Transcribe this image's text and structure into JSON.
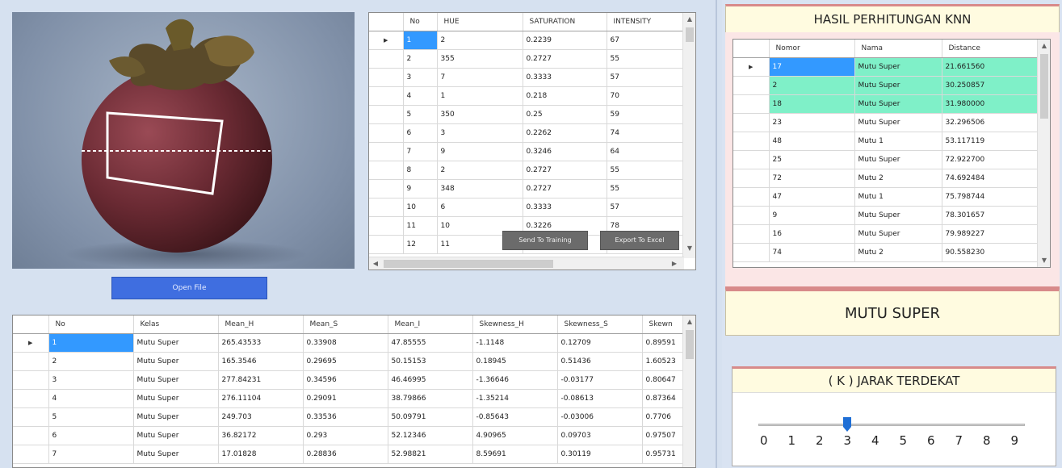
{
  "buttons": {
    "open_file": "Open File",
    "send_training": "Send To Training",
    "export_excel": "Export To Excel"
  },
  "pixel_grid": {
    "columns": [
      "No",
      "HUE",
      "SATURATION",
      "INTENSITY"
    ],
    "rows": [
      [
        "1",
        "2",
        "0.2239",
        "67"
      ],
      [
        "2",
        "355",
        "0.2727",
        "55"
      ],
      [
        "3",
        "7",
        "0.3333",
        "57"
      ],
      [
        "4",
        "1",
        "0.218",
        "70"
      ],
      [
        "5",
        "350",
        "0.25",
        "59"
      ],
      [
        "6",
        "3",
        "0.2262",
        "74"
      ],
      [
        "7",
        "9",
        "0.3246",
        "64"
      ],
      [
        "8",
        "2",
        "0.2727",
        "55"
      ],
      [
        "9",
        "348",
        "0.2727",
        "55"
      ],
      [
        "10",
        "6",
        "0.3333",
        "57"
      ],
      [
        "11",
        "10",
        "0.3226",
        "78"
      ],
      [
        "12",
        "11",
        "",
        ""
      ]
    ]
  },
  "training_grid": {
    "columns": [
      "No",
      "Kelas",
      "Mean_H",
      "Mean_S",
      "Mean_I",
      "Skewness_H",
      "Skewness_S",
      "Skewn"
    ],
    "rows": [
      [
        "1",
        "Mutu Super",
        "265.43533",
        "0.33908",
        "47.85555",
        "-1.1148",
        "0.12709",
        "0.89591"
      ],
      [
        "2",
        "Mutu Super",
        "165.3546",
        "0.29695",
        "50.15153",
        "0.18945",
        "0.51436",
        "1.60523"
      ],
      [
        "3",
        "Mutu Super",
        "277.84231",
        "0.34596",
        "46.46995",
        "-1.36646",
        "-0.03177",
        "0.80647"
      ],
      [
        "4",
        "Mutu Super",
        "276.11104",
        "0.29091",
        "38.79866",
        "-1.35214",
        "-0.08613",
        "0.87364"
      ],
      [
        "5",
        "Mutu Super",
        "249.703",
        "0.33536",
        "50.09791",
        "-0.85643",
        "-0.03006",
        "0.7706"
      ],
      [
        "6",
        "Mutu Super",
        "36.82172",
        "0.293",
        "52.12346",
        "4.90965",
        "0.09703",
        "0.97507"
      ],
      [
        "7",
        "Mutu Super",
        "17.01828",
        "0.28836",
        "52.98821",
        "8.59691",
        "0.30119",
        "0.95731"
      ]
    ]
  },
  "knn": {
    "title": "HASIL PERHITUNGAN KNN",
    "columns": [
      "Nomor",
      "Nama",
      "Distance"
    ],
    "rows": [
      [
        "17",
        "Mutu Super",
        "21.661560"
      ],
      [
        "2",
        "Mutu Super",
        "30.250857"
      ],
      [
        "18",
        "Mutu Super",
        "31.980000"
      ],
      [
        "23",
        "Mutu Super",
        "32.296506"
      ],
      [
        "48",
        "Mutu 1",
        "53.117119"
      ],
      [
        "25",
        "Mutu Super",
        "72.922700"
      ],
      [
        "72",
        "Mutu 2",
        "74.692484"
      ],
      [
        "47",
        "Mutu 1",
        "75.798744"
      ],
      [
        "9",
        "Mutu Super",
        "78.301657"
      ],
      [
        "16",
        "Mutu Super",
        "79.989227"
      ],
      [
        "74",
        "Mutu 2",
        "90.558230"
      ]
    ],
    "highlighted_count": 3
  },
  "result": {
    "label": "MUTU SUPER"
  },
  "k_slider": {
    "title": "( K ) JARAK TERDEKAT",
    "ticks": [
      "0",
      "1",
      "2",
      "3",
      "4",
      "5",
      "6",
      "7",
      "8",
      "9"
    ],
    "value": 3,
    "accent": "#1f6fd6"
  },
  "colors": {
    "selection": "#3399ff",
    "highlight": "#7ff0c8",
    "button": "#3f6ee0"
  }
}
